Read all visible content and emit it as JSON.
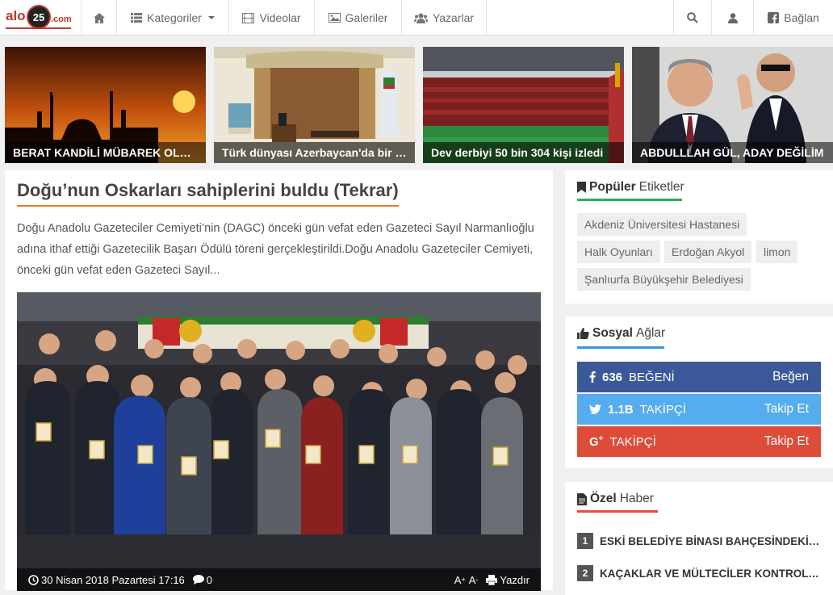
{
  "nav": {
    "logo_text": "alo",
    "logo_num": "25",
    "logo_domain": ".com",
    "items": [
      {
        "label": "Kategoriler"
      },
      {
        "label": "Videolar"
      },
      {
        "label": "Galeriler"
      },
      {
        "label": "Yazarlar"
      }
    ],
    "connect_label": "Bağlan"
  },
  "headlines": [
    {
      "caption": "BERAT KANDİLİ MÜBAREK OLSUN"
    },
    {
      "caption": "Türk dünyası Azerbaycan'da bir araya geldi"
    },
    {
      "caption": "Dev derbiyi 50 bin 304 kişi izledi"
    },
    {
      "caption": "ABDULLLAH GÜL, ADAY DEĞİLİM"
    }
  ],
  "article": {
    "title": "Doğu’nun Oskarları sahiplerini buldu (Tekrar)",
    "summary": "Doğu Anadolu Gazeteciler Cemiyeti’nin (DAGC) önceki gün vefat eden Gazeteci Sayıl Narmanlıoğlu adına ithaf ettiği Gazetecilik Başarı Ödülü töreni gerçekleştirildi.Doğu Anadolu Gazeteciler Cemiyeti, önceki gün vefat eden Gazeteci Sayıl...",
    "date": "30 Nisan 2018 Pazartesi 17:16",
    "comments": "0",
    "font_size_up": "A",
    "font_size_up_sign": "+",
    "font_size_down": "A",
    "font_size_down_sign": "-",
    "print_label": "Yazdır"
  },
  "popular_tags": {
    "title_bold": "Popüler",
    "title_rest": "Etiketler",
    "tags": [
      "Akdeniz Üniversitesi Hastanesi",
      "Halk Oyunları",
      "Erdoğan Akyol",
      "limon",
      "Şanlıurfa Büyükşehir Belediyesi"
    ]
  },
  "social": {
    "title_bold": "Sosyal",
    "title_rest": "Ağlar",
    "items": [
      {
        "icon": "facebook-icon",
        "count": "636",
        "label": "BEĞENİ",
        "action": "Beğen",
        "color": "#3b5998"
      },
      {
        "icon": "twitter-icon",
        "count": "1.1B",
        "label": "TAKİPÇİ",
        "action": "Takip Et",
        "color": "#55acee"
      },
      {
        "icon": "google-plus-icon",
        "count": "",
        "label": "TAKİPÇİ",
        "action": "Takip Et",
        "color": "#dd4b39"
      }
    ]
  },
  "special_news": {
    "title_bold": "Özel",
    "title_rest": "Haber",
    "items": [
      {
        "num": "1",
        "title": "ESKİ BELEDİYE BİNASI BAHÇESİNDEKİ ÇAY OCAĞI"
      },
      {
        "num": "2",
        "title": "KAÇAKLAR VE MÜLTECİLER KONTROL ALTINA"
      }
    ]
  },
  "colors": {
    "accent": "#e67e22",
    "blue_line": "#3498db",
    "red_line": "#e74c3c",
    "green_line": "#27ae60"
  }
}
